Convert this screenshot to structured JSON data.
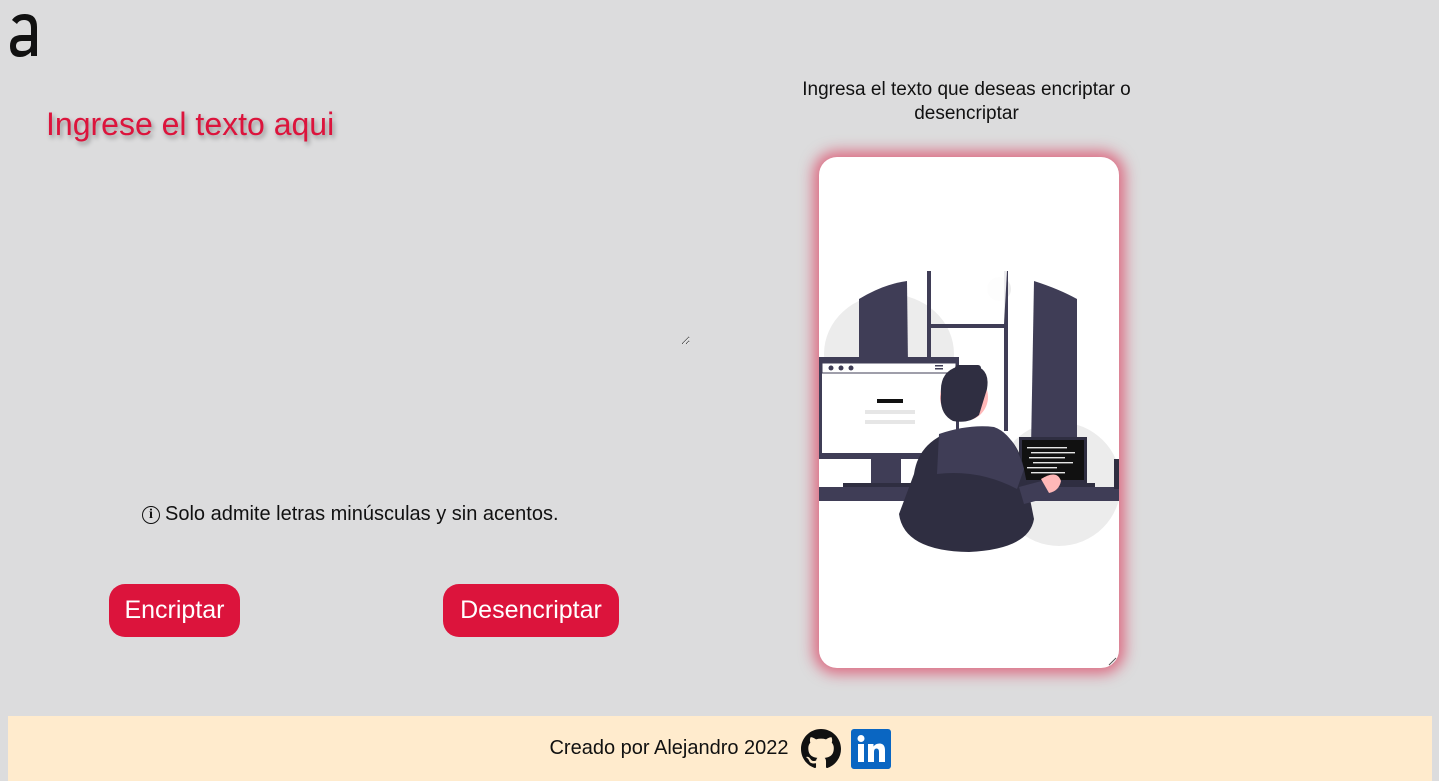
{
  "app": {
    "logo_icon": "alura-logo-icon"
  },
  "input": {
    "placeholder": "Ingrese el texto aqui",
    "value": ""
  },
  "hint": {
    "icon": "info-icon",
    "text": "Solo admite letras minúsculas y sin acentos."
  },
  "buttons": {
    "encrypt_label": "Encriptar",
    "decrypt_label": "Desencriptar"
  },
  "output": {
    "label": "Ingresa el texto que deseas encriptar o desencriptar",
    "value": ""
  },
  "footer": {
    "text": "Creado por Alejandro 2022",
    "github_icon": "github-icon",
    "linkedin_icon": "linkedin-icon"
  },
  "colors": {
    "accent": "#dc143c",
    "background": "#dcdcdd",
    "footer_bg": "#ffebcd",
    "linkedin": "#0a66c2"
  }
}
